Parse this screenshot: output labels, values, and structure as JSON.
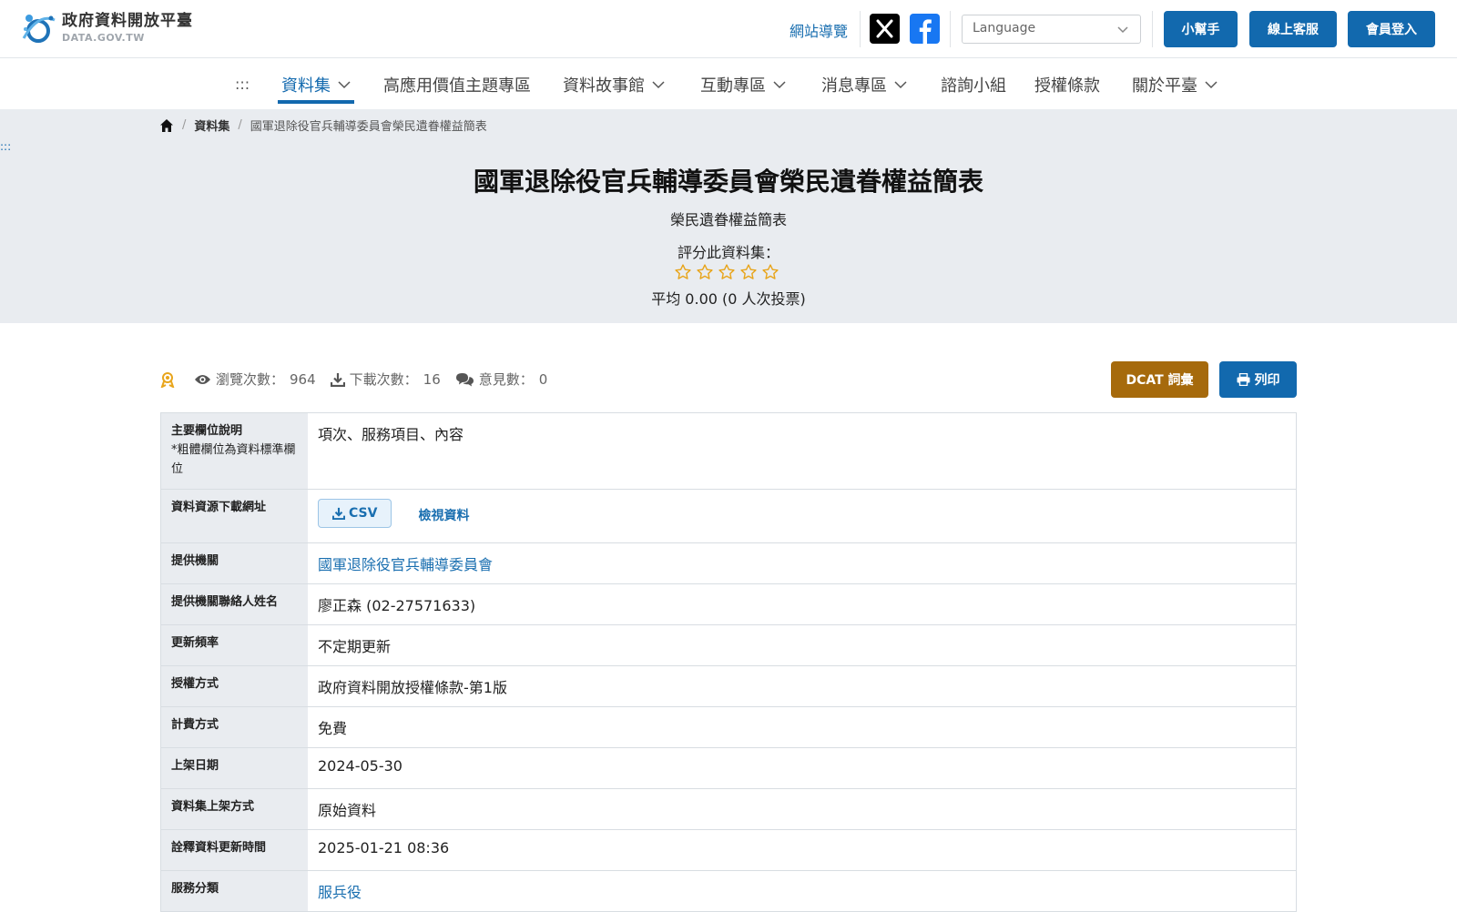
{
  "header": {
    "logo_title": "政府資料開放平臺",
    "logo_sub": "DATA.GOV.TW",
    "sitemap_label": "網站導覽",
    "language_label": "Language",
    "helper_label": "小幫手",
    "support_label": "線上客服",
    "login_label": "會員登入"
  },
  "nav": {
    "dots": ":::",
    "items": [
      "資料集",
      "高應用價值主題專區",
      "資料故事館",
      "互動專區",
      "消息專區",
      "諮詢小組",
      "授權條款",
      "關於平臺"
    ]
  },
  "breadcrumb": {
    "level1": "資料集",
    "current": "國軍退除役官兵輔導委員會榮民遺眷權益簡表"
  },
  "hero": {
    "anchor": ":::",
    "title": "國軍退除役官兵輔導委員會榮民遺眷權益簡表",
    "subtitle": "榮民遺眷權益簡表",
    "rate_label": "評分此資料集：",
    "rating": 0,
    "rating_max": 5,
    "rate_average": "平均 0.00 (0 人次投票)"
  },
  "stats": {
    "views_label": "瀏覽次數：",
    "views": "964",
    "downloads_label": "下載次數：",
    "downloads": "16",
    "comments_label": "意見數：",
    "comments": "0"
  },
  "actions": {
    "dcat_label": "DCAT 詞彙",
    "print_label": "列印"
  },
  "table": {
    "fields_label": "主要欄位說明",
    "fields_note": "*粗體欄位為資料標準欄位",
    "fields_value": "項次、服務項目、內容",
    "download_label": "資料資源下載網址",
    "csv_label": "CSV",
    "view_label": "檢視資料",
    "org_label": "提供機關",
    "org_value": "國軍退除役官兵輔導委員會",
    "contact_label": "提供機關聯絡人姓名",
    "contact_value": "廖正森 (02-27571633)",
    "freq_label": "更新頻率",
    "freq_value": "不定期更新",
    "license_label": "授權方式",
    "license_value": "政府資料開放授權條款-第1版",
    "fee_label": "計費方式",
    "fee_value": "免費",
    "published_label": "上架日期",
    "published_value": "2024-05-30",
    "method_label": "資料集上架方式",
    "method_value": "原始資料",
    "meta_updated_label": "詮釋資料更新時間",
    "meta_updated_value": "2025-01-21 08:36",
    "category_label": "服務分類",
    "category_value": "服兵役"
  },
  "colors": {
    "primary": "#1269ae",
    "dcat": "#a66a0c",
    "star": "#e8a51c",
    "hero_bg": "#e9ecf0"
  }
}
